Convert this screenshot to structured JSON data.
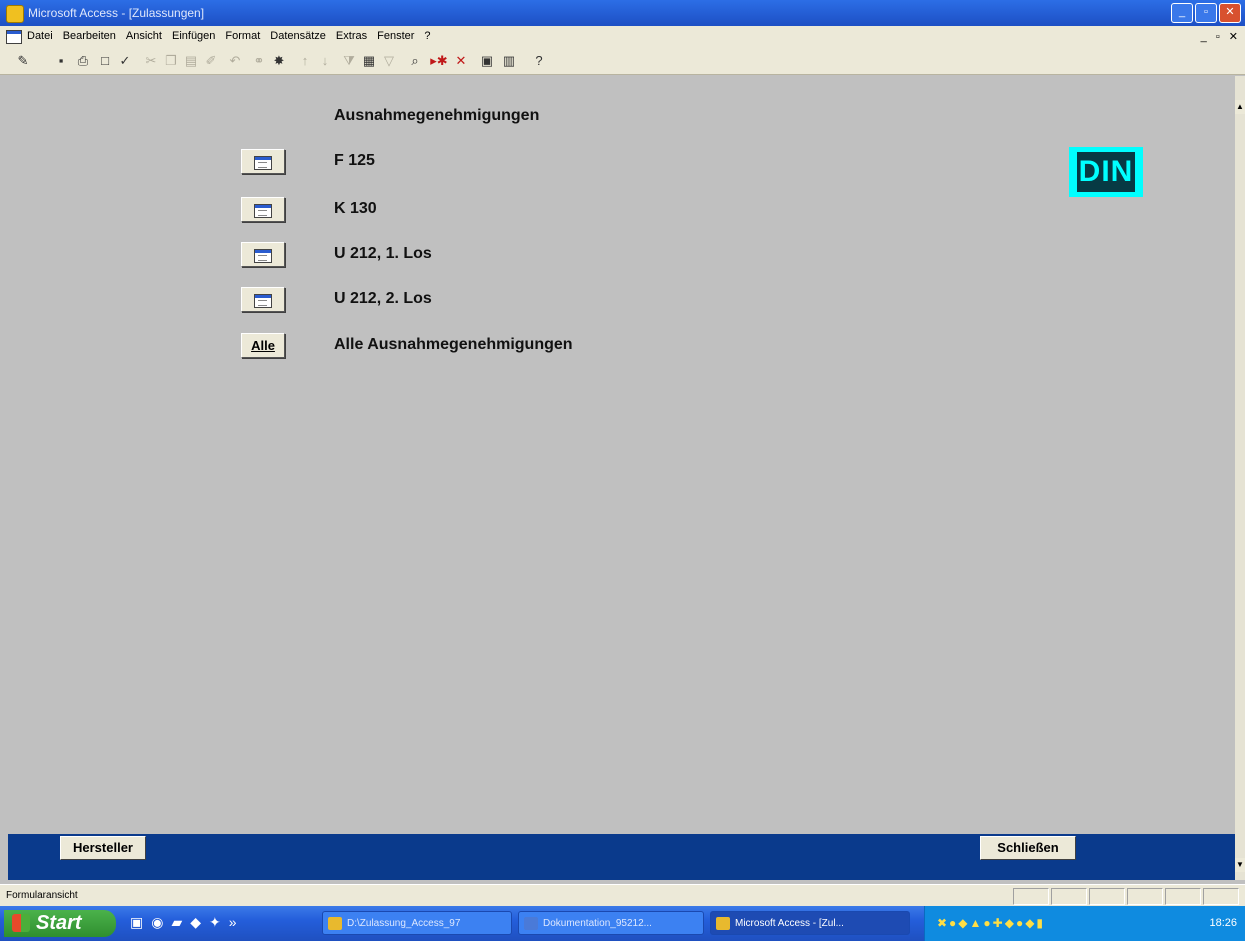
{
  "window": {
    "title": "Microsoft Access - [Zulassungen]",
    "buttons": [
      "_",
      "▫",
      "✕"
    ]
  },
  "menubar": {
    "items": [
      "Datei",
      "Bearbeiten",
      "Ansicht",
      "Einfügen",
      "Format",
      "Datensätze",
      "Extras",
      "Fenster",
      "?"
    ],
    "mdi_controls": "_ ▫ ✕"
  },
  "toolbar": {
    "icons": [
      "design-view-icon",
      "save-icon",
      "print-icon",
      "print-preview-icon",
      "spelling-icon",
      "cut-icon",
      "copy-icon",
      "paste-icon",
      "format-painter-icon",
      "undo-icon",
      "hyperlink-icon",
      "web-icon",
      "sort-ascending-icon",
      "sort-descending-icon",
      "filter-by-selection-icon",
      "filter-by-form-icon",
      "apply-filter-icon",
      "find-icon",
      "new-record-icon",
      "delete-record-icon",
      "database-window-icon",
      "new-object-icon",
      "help-icon"
    ]
  },
  "form": {
    "heading": "Ausnahmegenehmigungen",
    "rows": [
      {
        "button": "",
        "label": "F 125"
      },
      {
        "button": "",
        "label": "K 130"
      },
      {
        "button": "",
        "label": "U 212, 1. Los"
      },
      {
        "button": "",
        "label": "U 212, 2. Los"
      },
      {
        "button": "Alle",
        "label": "Alle Ausnahmegenehmigungen"
      }
    ],
    "logo": "DIN"
  },
  "footer": {
    "left_button": "Hersteller",
    "right_button": "Schließen"
  },
  "statusbar": {
    "text": "Formularansicht"
  },
  "taskbar": {
    "start": "Start",
    "overflow": "»",
    "tasks": [
      {
        "label": "D:\\Zulassung_Access_97"
      },
      {
        "label": "Dokumentation_95212..."
      },
      {
        "label": "Microsoft Access - [Zul..."
      }
    ],
    "clock": "18:26"
  },
  "colors": {
    "form_bg": "#c0c0c0",
    "footer_bg": "#0a3a8c",
    "logo_bg": "#00ffff",
    "logo_text_bg": "#073a44"
  }
}
